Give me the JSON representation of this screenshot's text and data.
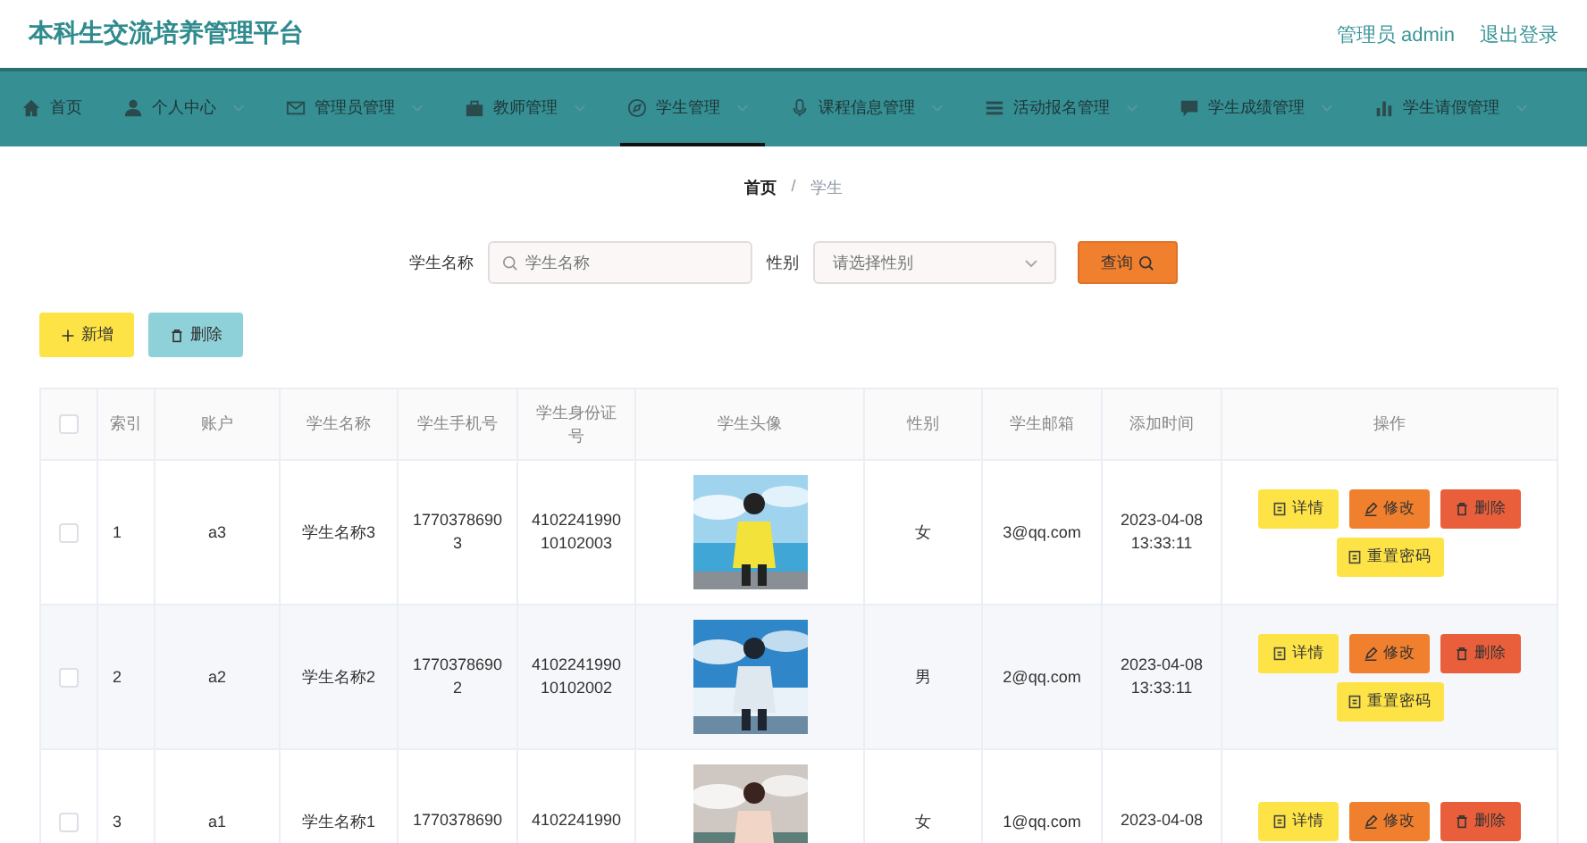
{
  "header": {
    "title": "本科生交流培养管理平台",
    "user": "管理员 admin",
    "logout": "退出登录"
  },
  "nav": [
    {
      "label": "首页",
      "dropdown": false,
      "selected": false
    },
    {
      "label": "个人中心",
      "dropdown": true,
      "selected": false
    },
    {
      "label": "管理员管理",
      "dropdown": true,
      "selected": false
    },
    {
      "label": "教师管理",
      "dropdown": true,
      "selected": false
    },
    {
      "label": "学生管理",
      "dropdown": true,
      "selected": true
    },
    {
      "label": "课程信息管理",
      "dropdown": true,
      "selected": false
    },
    {
      "label": "活动报名管理",
      "dropdown": true,
      "selected": false
    },
    {
      "label": "学生成绩管理",
      "dropdown": true,
      "selected": false
    },
    {
      "label": "学生请假管理",
      "dropdown": true,
      "selected": false
    }
  ],
  "breadcrumb": {
    "items": [
      "首页",
      "学生"
    ],
    "separator": "/"
  },
  "search": {
    "name_label": "学生名称",
    "name_placeholder": "学生名称",
    "gender_label": "性别",
    "gender_placeholder": "请选择性别",
    "query_button": "查询"
  },
  "actions": {
    "add": "新增",
    "delete": "删除"
  },
  "table": {
    "select_all_checked": false,
    "columns": [
      "索引",
      "账户",
      "学生名称",
      "学生手机号",
      "学生身份证号",
      "学生头像",
      "性别",
      "学生邮箱",
      "添加时间",
      "操作"
    ],
    "rows": [
      {
        "checked": false,
        "index": "1",
        "account": "a3",
        "name": "学生名称3",
        "phone": "17703786903",
        "id_number": "410224199010102003",
        "gender": "女",
        "email": "3@qq.com",
        "time": "2023-04-08 13:33:11",
        "buttons": [
          {
            "kind": "detail",
            "label": "详情"
          },
          {
            "kind": "edit",
            "label": "修改"
          },
          {
            "kind": "delete",
            "label": "删除"
          },
          {
            "kind": "reset",
            "label": "重置密码"
          }
        ]
      },
      {
        "checked": false,
        "index": "2",
        "account": "a2",
        "name": "学生名称2",
        "phone": "17703786902",
        "id_number": "410224199010102002",
        "gender": "男",
        "email": "2@qq.com",
        "time": "2023-04-08 13:33:11",
        "buttons": [
          {
            "kind": "detail",
            "label": "详情"
          },
          {
            "kind": "edit",
            "label": "修改"
          },
          {
            "kind": "delete",
            "label": "删除"
          },
          {
            "kind": "reset",
            "label": "重置密码"
          }
        ]
      },
      {
        "checked": false,
        "index": "3",
        "account": "a1",
        "name": "学生名称1",
        "phone": "1770378690",
        "id_number": "4102241990",
        "gender": "女",
        "email": "1@qq.com",
        "time": "2023-04-08",
        "buttons": [
          {
            "kind": "detail",
            "label": "详情"
          },
          {
            "kind": "edit",
            "label": "修改"
          },
          {
            "kind": "delete",
            "label": "删除"
          }
        ]
      }
    ]
  }
}
